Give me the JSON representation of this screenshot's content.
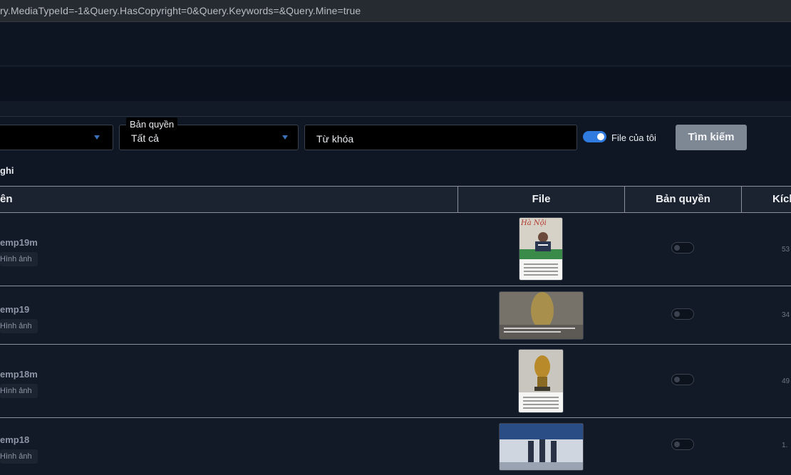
{
  "browser": {
    "url_fragment": "ry.MediaTypeId=-1&Query.HasCopyright=0&Query.Keywords=&Query.Mine=true"
  },
  "filters": {
    "copyright_label": "Bản quyền",
    "copyright_value": "Tất cả",
    "keyword_placeholder": "Từ khóa",
    "mine_label": "File của tôi",
    "mine_checked": true,
    "search_button": "Tìm kiếm"
  },
  "info_text": "ghi",
  "table": {
    "headers": [
      "ên",
      "File",
      "Bản quyền",
      "Kích"
    ],
    "rows": [
      {
        "name": "emp19m",
        "type": "Hình ảnh",
        "size": "53",
        "copyright": false
      },
      {
        "name": "emp19",
        "type": "Hình ảnh",
        "size": "34",
        "copyright": false
      },
      {
        "name": "emp18m",
        "type": "Hình ảnh",
        "size": "49",
        "copyright": false
      },
      {
        "name": "emp18",
        "type": "Hình ảnh",
        "size": "1.",
        "copyright": false
      }
    ]
  },
  "colors": {
    "background": "#0f1724",
    "toggle_on": "#2f7be0",
    "search_button": "#7e8794",
    "caret": "#3c6fb9"
  }
}
